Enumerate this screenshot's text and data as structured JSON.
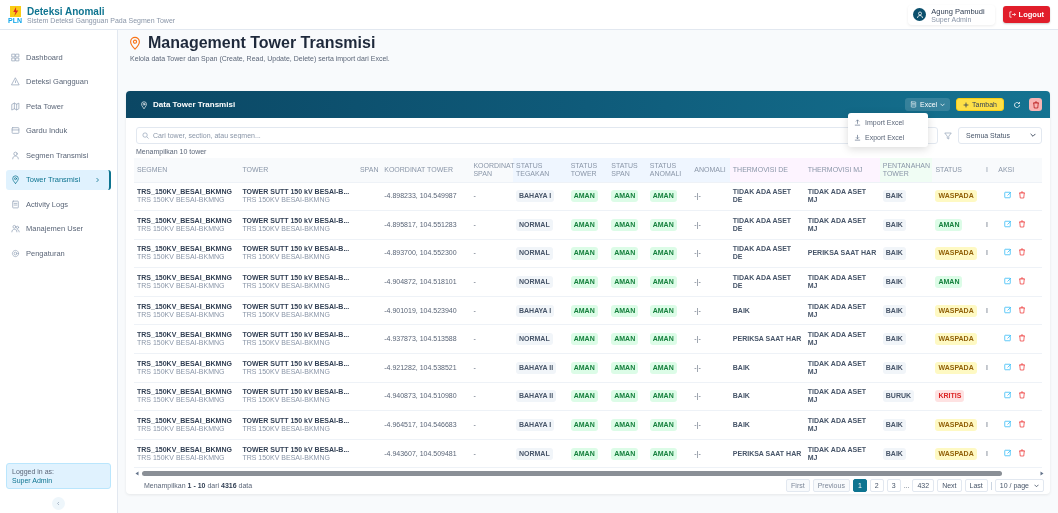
{
  "header": {
    "logo_text": "PLN",
    "app_title": "Deteksi Anomali",
    "app_subtitle": "Sistem Deteksi Gangguan Pada Segmen Tower",
    "user_name": "Agung Pambudi",
    "user_role": "Super Admin",
    "logout": "Logout"
  },
  "sidebar": {
    "items": [
      {
        "label": "Dashboard",
        "selected": false
      },
      {
        "label": "Deteksi Gangguan",
        "selected": false
      },
      {
        "label": "Peta Tower",
        "selected": false
      },
      {
        "label": "Gardu Induk",
        "selected": false
      },
      {
        "label": "Segmen Transmisi",
        "selected": false
      },
      {
        "label": "Tower Transmisi",
        "selected": true
      },
      {
        "label": "Activity Logs",
        "selected": false
      },
      {
        "label": "Manajemen User",
        "selected": false
      },
      {
        "label": "Pengaturan",
        "selected": false
      }
    ],
    "logged_in_label": "Logged in as:",
    "logged_in_role": "Super Admin"
  },
  "page": {
    "title": "Management Tower Transmisi",
    "description": "Kelola data Tower dan Span (Create, Read, Update, Delete) serta import dari Excel."
  },
  "card": {
    "title": "Data Tower Transmisi",
    "excel_button": "Excel",
    "add_button": "Tambah",
    "excel_menu": [
      "Import Excel",
      "Export Excel"
    ],
    "search": {
      "placeholder": "Cari tower, section, atau segmen..."
    },
    "filter": "Semua Status",
    "count_text": "Menampilkan 10 tower"
  },
  "table": {
    "columns": [
      "SEGMEN",
      "TOWER",
      "SPAN",
      "KOORDINAT TOWER",
      "KOORDINAT SPAN",
      "STATUS TEGAKAN",
      "STATUS TOWER",
      "STATUS SPAN",
      "STATUS ANOMALI",
      "ANOMALI",
      "THERMOVISI DE",
      "THERMOVISI MJ",
      "PENTANAHAN TOWER",
      "STATUS",
      "I",
      "AKSI"
    ],
    "rows": [
      {
        "segmen": "TRS_150KV_BESAI_BKMNG",
        "segmen_sub": "TRS 150KV BESAI-BKMNG",
        "tower": "TOWER SUTT 150 kV BESAI-B...",
        "tower_sub": "TRS 150KV BESAI-BKMNG",
        "koordinat_tower": "-4.898233, 104.549987",
        "koordinat_span": "-",
        "status_tegakan": "BAHAYA I",
        "status_tower": "AMAN",
        "status_span": "AMAN",
        "status_anomali": "AMAN",
        "anomali": "-|-",
        "thermovisi_de": "TIDAK ADA ASET DE",
        "thermovisi_mj": "TIDAK ADA ASET MJ",
        "pentanahan": "BAIK",
        "status": {
          "label": "WASPADA",
          "kind": "warn"
        }
      },
      {
        "segmen": "TRS_150KV_BESAI_BKMNG",
        "segmen_sub": "TRS 150KV BESAI-BKMNG",
        "tower": "TOWER SUTT 150 kV BESAI-B...",
        "tower_sub": "TRS 150KV BESAI-BKMNG",
        "koordinat_tower": "-4.895817, 104.551283",
        "koordinat_span": "-",
        "status_tegakan": "NORMAL",
        "status_tower": "AMAN",
        "status_span": "AMAN",
        "status_anomali": "AMAN",
        "anomali": "-|-",
        "thermovisi_de": "TIDAK ADA ASET DE",
        "thermovisi_mj": "TIDAK ADA ASET MJ",
        "pentanahan": "BAIK",
        "status": {
          "label": "AMAN",
          "kind": "ok"
        },
        "column_15": "I"
      },
      {
        "segmen": "TRS_150KV_BESAI_BKMNG",
        "segmen_sub": "TRS 150KV BESAI-BKMNG",
        "tower": "TOWER SUTT 150 kV BESAI-B...",
        "tower_sub": "TRS 150KV BESAI-BKMNG",
        "koordinat_tower": "-4.893700, 104.552300",
        "koordinat_span": "-",
        "status_tegakan": "NORMAL",
        "status_tower": "AMAN",
        "status_span": "AMAN",
        "status_anomali": "AMAN",
        "anomali": "-|-",
        "thermovisi_de": "TIDAK ADA ASET DE",
        "thermovisi_mj": "PERIKSA SAAT HAR",
        "pentanahan": "BAIK",
        "status": {
          "label": "WASPADA",
          "kind": "warn"
        },
        "column_15": "I"
      },
      {
        "segmen": "TRS_150KV_BESAI_BKMNG",
        "segmen_sub": "TRS 150KV BESAI-BKMNG",
        "tower": "TOWER SUTT 150 kV BESAI-B...",
        "tower_sub": "TRS 150KV BESAI-BKMNG",
        "koordinat_tower": "-4.904872, 104.518101",
        "koordinat_span": "-",
        "status_tegakan": "NORMAL",
        "status_tower": "AMAN",
        "status_span": "AMAN",
        "status_anomali": "AMAN",
        "anomali": "-|-",
        "thermovisi_de": "TIDAK ADA ASET DE",
        "thermovisi_mj": "TIDAK ADA ASET MJ",
        "pentanahan": "BAIK",
        "status": {
          "label": "AMAN",
          "kind": "ok"
        }
      },
      {
        "segmen": "TRS_150KV_BESAI_BKMNG",
        "segmen_sub": "TRS 150KV BESAI-BKMNG",
        "tower": "TOWER SUTT 150 kV BESAI-B...",
        "tower_sub": "TRS 150KV BESAI-BKMNG",
        "koordinat_tower": "-4.901019, 104.523940",
        "koordinat_span": "-",
        "status_tegakan": "BAHAYA I",
        "status_tower": "AMAN",
        "status_span": "AMAN",
        "status_anomali": "AMAN",
        "anomali": "-|-",
        "thermovisi_de": "BAIK",
        "thermovisi_mj": "TIDAK ADA ASET MJ",
        "pentanahan": "BAIK",
        "status": {
          "label": "WASPADA",
          "kind": "warn"
        },
        "column_15": "I"
      },
      {
        "segmen": "TRS_150KV_BESAI_BKMNG",
        "segmen_sub": "TRS 150KV BESAI-BKMNG",
        "tower": "TOWER SUTT 150 kV BESAI-B...",
        "tower_sub": "TRS 150KV BESAI-BKMNG",
        "koordinat_tower": "-4.937873, 104.513588",
        "koordinat_span": "-",
        "status_tegakan": "NORMAL",
        "status_tower": "AMAN",
        "status_span": "AMAN",
        "status_anomali": "AMAN",
        "anomali": "-|-",
        "thermovisi_de": "PERIKSA SAAT HAR",
        "thermovisi_mj": "TIDAK ADA ASET MJ",
        "pentanahan": "BAIK",
        "status": {
          "label": "WASPADA",
          "kind": "warn"
        }
      },
      {
        "segmen": "TRS_150KV_BESAI_BKMNG",
        "segmen_sub": "TRS 150KV BESAI-BKMNG",
        "tower": "TOWER SUTT 150 kV BESAI-B...",
        "tower_sub": "TRS 150KV BESAI-BKMNG",
        "koordinat_tower": "-4.921282, 104.538521",
        "koordinat_span": "-",
        "status_tegakan": "BAHAYA II",
        "status_tower": "AMAN",
        "status_span": "AMAN",
        "status_anomali": "AMAN",
        "anomali": "-|-",
        "thermovisi_de": "BAIK",
        "thermovisi_mj": "TIDAK ADA ASET MJ",
        "pentanahan": "BAIK",
        "status": {
          "label": "WASPADA",
          "kind": "warn"
        },
        "column_15": "I"
      },
      {
        "segmen": "TRS_150KV_BESAI_BKMNG",
        "segmen_sub": "TRS 150KV BESAI-BKMNG",
        "tower": "TOWER SUTT 150 kV BESAI-B...",
        "tower_sub": "TRS 150KV BESAI-BKMNG",
        "koordinat_tower": "-4.940873, 104.510980",
        "koordinat_span": "-",
        "status_tegakan": "BAHAYA II",
        "status_tower": "AMAN",
        "status_span": "AMAN",
        "status_anomali": "AMAN",
        "anomali": "-|-",
        "thermovisi_de": "BAIK",
        "thermovisi_mj": "TIDAK ADA ASET MJ",
        "pentanahan": "BURUK",
        "status": {
          "label": "KRITIS",
          "kind": "critical"
        }
      },
      {
        "segmen": "TRS_150KV_BESAI_BKMNG",
        "segmen_sub": "TRS 150KV BESAI-BKMNG",
        "tower": "TOWER SUTT 150 kV BESAI-B...",
        "tower_sub": "TRS 150KV BESAI-BKMNG",
        "koordinat_tower": "-4.964517, 104.546683",
        "koordinat_span": "-",
        "status_tegakan": "BAHAYA I",
        "status_tower": "AMAN",
        "status_span": "AMAN",
        "status_anomali": "AMAN",
        "anomali": "-|-",
        "thermovisi_de": "BAIK",
        "thermovisi_mj": "TIDAK ADA ASET MJ",
        "pentanahan": "BAIK",
        "status": {
          "label": "WASPADA",
          "kind": "warn"
        },
        "column_15": "I"
      },
      {
        "segmen": "TRS_150KV_BESAI_BKMNG",
        "segmen_sub": "TRS 150KV BESAI-BKMNG",
        "tower": "TOWER SUTT 150 kV BESAI-B...",
        "tower_sub": "TRS 150KV BESAI-BKMNG",
        "koordinat_tower": "-4.943607, 104.509481",
        "koordinat_span": "-",
        "status_tegakan": "NORMAL",
        "status_tower": "AMAN",
        "status_span": "AMAN",
        "status_anomali": "AMAN",
        "anomali": "-|-",
        "thermovisi_de": "PERIKSA SAAT HAR",
        "thermovisi_mj": "TIDAK ADA ASET MJ",
        "pentanahan": "BAIK",
        "status": {
          "label": "WASPADA",
          "kind": "warn"
        },
        "column_15": "I"
      }
    ]
  },
  "footer": {
    "summary": "Menampilkan **1 - 10** dari **4316** data",
    "pages": [
      {
        "label": "First",
        "kind": "nav",
        "disabled": true
      },
      {
        "label": "Previous",
        "kind": "nav",
        "disabled": true
      },
      {
        "label": "1",
        "kind": "page",
        "selected": true
      },
      {
        "label": "2",
        "kind": "page",
        "selected": false
      },
      {
        "label": "3",
        "kind": "page",
        "selected": false
      },
      {
        "label": "...",
        "kind": "ellipsis"
      },
      {
        "label": "432",
        "kind": "page",
        "selected": false
      },
      {
        "label": "Next",
        "kind": "nav",
        "disabled": false
      },
      {
        "label": "Last",
        "kind": "nav",
        "disabled": false
      }
    ],
    "page_size": "10 / page"
  }
}
